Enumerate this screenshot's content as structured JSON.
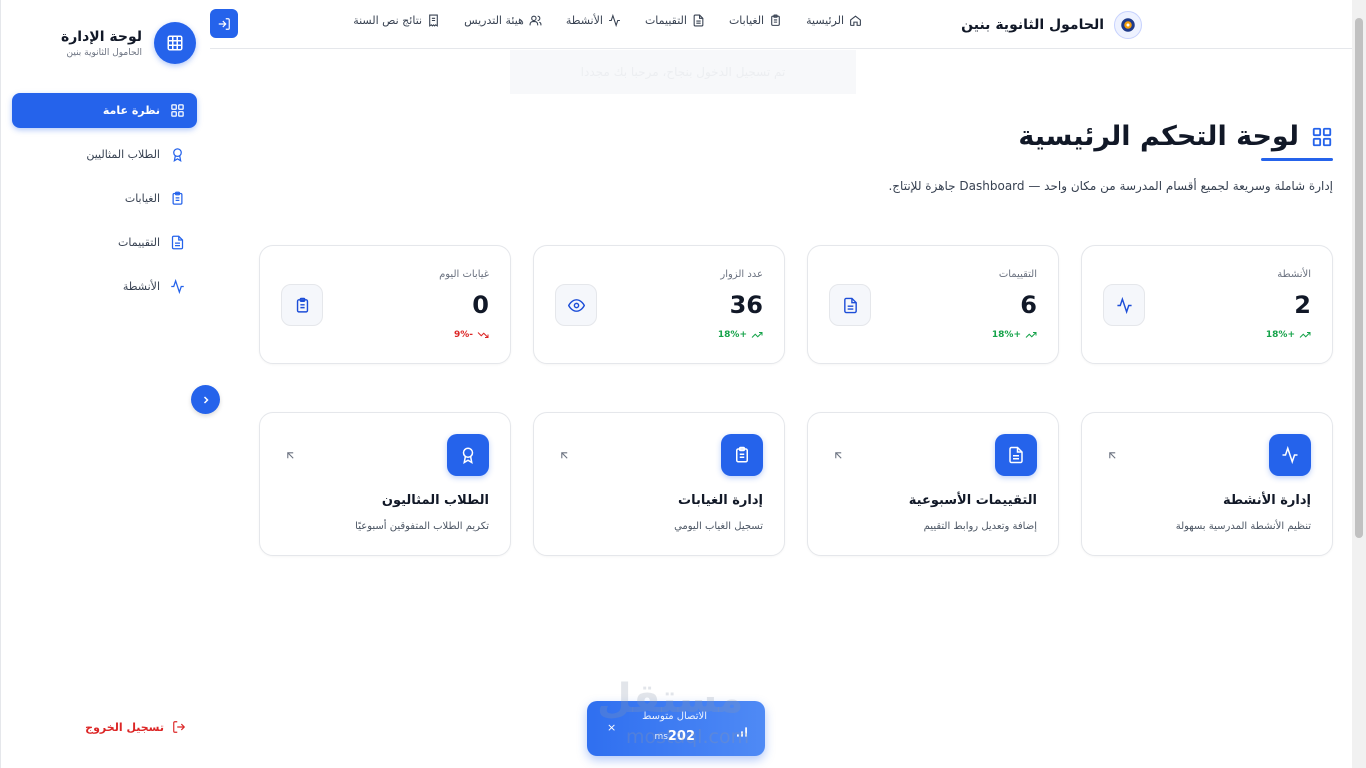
{
  "brand": {
    "title": "الحامول الثانوية بنين"
  },
  "nav": [
    {
      "label": "الرئيسية",
      "icon": "home-icon"
    },
    {
      "label": "الغيابات",
      "icon": "clipboard-icon"
    },
    {
      "label": "التقييمات",
      "icon": "file-text-icon"
    },
    {
      "label": "الأنشطة",
      "icon": "activity-icon"
    },
    {
      "label": "هيئة التدريس",
      "icon": "users-icon"
    },
    {
      "label": "نتائج نص السنة",
      "icon": "receipt-icon"
    }
  ],
  "ghost_toast": "تم تسجيل الدخول بنجاح، مرحبا بك مجددا",
  "sidebar": {
    "title": "لوحة الإدارة",
    "subtitle": "الحامول الثانوية بنين",
    "items": [
      {
        "label": "نظرة عامة",
        "icon": "layout-grid-icon",
        "active": true
      },
      {
        "label": "الطلاب المثاليين",
        "icon": "award-icon",
        "active": false
      },
      {
        "label": "الغيابات",
        "icon": "clipboard-icon",
        "active": false
      },
      {
        "label": "التقييمات",
        "icon": "file-text-icon",
        "active": false
      },
      {
        "label": "الأنشطة",
        "icon": "activity-icon",
        "active": false
      }
    ],
    "logout": "تسجيل الخروج"
  },
  "page": {
    "title": "لوحة التحكم الرئيسية",
    "description": "إدارة شاملة وسريعة لجميع أقسام المدرسة من مكان واحد — Dashboard جاهزة للإنتاج."
  },
  "stats": [
    {
      "label": "الأنشطة",
      "value": "2",
      "trend": "+18%",
      "direction": "up",
      "icon": "activity-icon"
    },
    {
      "label": "التقييمات",
      "value": "6",
      "trend": "+18%",
      "direction": "up",
      "icon": "file-text-icon"
    },
    {
      "label": "عدد الزوار",
      "value": "36",
      "trend": "+18%",
      "direction": "up",
      "icon": "eye-icon"
    },
    {
      "label": "غيابات اليوم",
      "value": "0",
      "trend": "-9%",
      "direction": "down",
      "icon": "clipboard-icon"
    }
  ],
  "modules": [
    {
      "title": "إدارة الأنشطة",
      "desc": "تنظيم الأنشطة المدرسية بسهولة",
      "icon": "activity-icon"
    },
    {
      "title": "التقييمات الأسبوعية",
      "desc": "إضافة وتعديل روابط التقييم",
      "icon": "file-text-icon"
    },
    {
      "title": "إدارة الغيابات",
      "desc": "تسجيل الغياب اليومي",
      "icon": "clipboard-icon"
    },
    {
      "title": "الطلاب المثاليون",
      "desc": "تكريم الطلاب المتفوقين أسبوعيًا",
      "icon": "award-icon"
    }
  ],
  "latency": {
    "label": "الاتصال متوسط",
    "value": "202",
    "unit": "ms",
    "close": "×"
  },
  "watermark": {
    "text": "مستقل",
    "sub": "mostaql.com"
  },
  "colors": {
    "accent": "#2563eb",
    "up": "#16a34a",
    "down": "#dc2626"
  }
}
